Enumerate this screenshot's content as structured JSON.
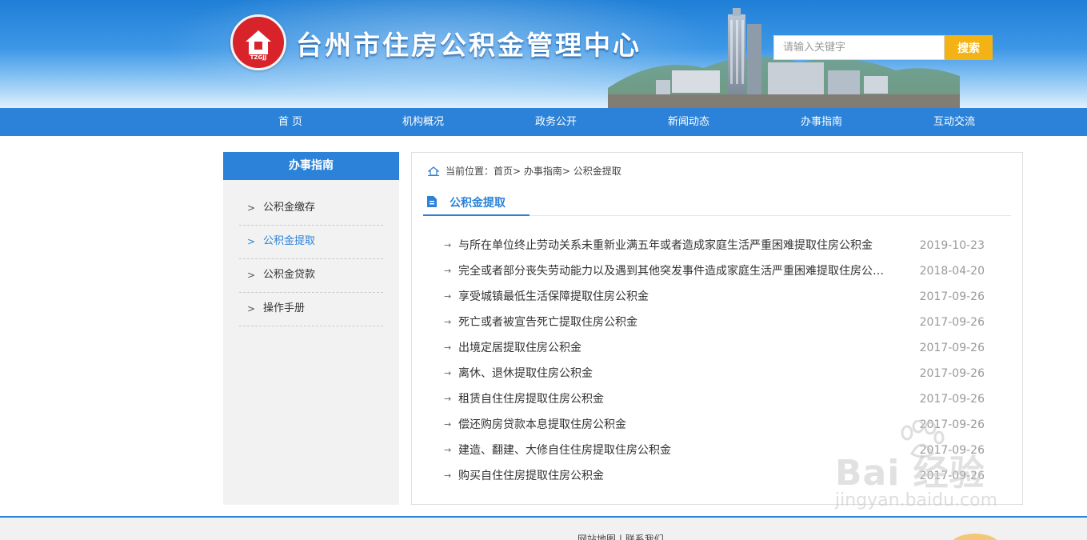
{
  "header": {
    "site_title": "台州市住房公积金管理中心",
    "logo_text": "TZGJJ",
    "search_placeholder": "请输入关键字",
    "search_button": "搜索"
  },
  "nav": {
    "items": [
      "首 页",
      "机构概况",
      "政务公开",
      "新闻动态",
      "办事指南",
      "互动交流"
    ]
  },
  "sidebar": {
    "title": "办事指南",
    "items": [
      {
        "label": "公积金缴存",
        "active": false
      },
      {
        "label": "公积金提取",
        "active": true
      },
      {
        "label": "公积金贷款",
        "active": false
      },
      {
        "label": "操作手册",
        "active": false
      }
    ]
  },
  "breadcrumb": {
    "prefix": "当前位置：",
    "path": "首页> 办事指南> 公积金提取"
  },
  "section": {
    "title": "公积金提取"
  },
  "articles": [
    {
      "title": "与所在单位终止劳动关系未重新业满五年或者造成家庭生活严重困难提取住房公积金",
      "date": "2019-10-23"
    },
    {
      "title": "完全或者部分丧失劳动能力以及遇到其他突发事件造成家庭生活严重困难提取住房公积金",
      "date": "2018-04-20"
    },
    {
      "title": "享受城镇最低生活保障提取住房公积金",
      "date": "2017-09-26"
    },
    {
      "title": "死亡或者被宣告死亡提取住房公积金",
      "date": "2017-09-26"
    },
    {
      "title": "出境定居提取住房公积金",
      "date": "2017-09-26"
    },
    {
      "title": "离休、退休提取住房公积金",
      "date": "2017-09-26"
    },
    {
      "title": "租赁自住住房提取住房公积金",
      "date": "2017-09-26"
    },
    {
      "title": "偿还购房贷款本息提取住房公积金",
      "date": "2017-09-26"
    },
    {
      "title": "建造、翻建、大修自住住房提取住房公积金",
      "date": "2017-09-26"
    },
    {
      "title": "购买自住住房提取住房公积金",
      "date": "2017-09-26"
    }
  ],
  "footer": {
    "link1": "网站地图",
    "separator": "|",
    "link2": "联系我们"
  },
  "watermark": {
    "main": "Bai 经验",
    "sub": "jingyan.baidu.com"
  },
  "icons": {
    "logo": "house-logo-icon",
    "breadcrumb": "home-icon",
    "section": "document-icon",
    "list_bullet": "arrow-right-icon",
    "sidebar_bullet": "chevron-right-icon"
  },
  "colors": {
    "primary": "#2b82d8",
    "search_button": "#f3b315",
    "logo": "#d9232a"
  }
}
